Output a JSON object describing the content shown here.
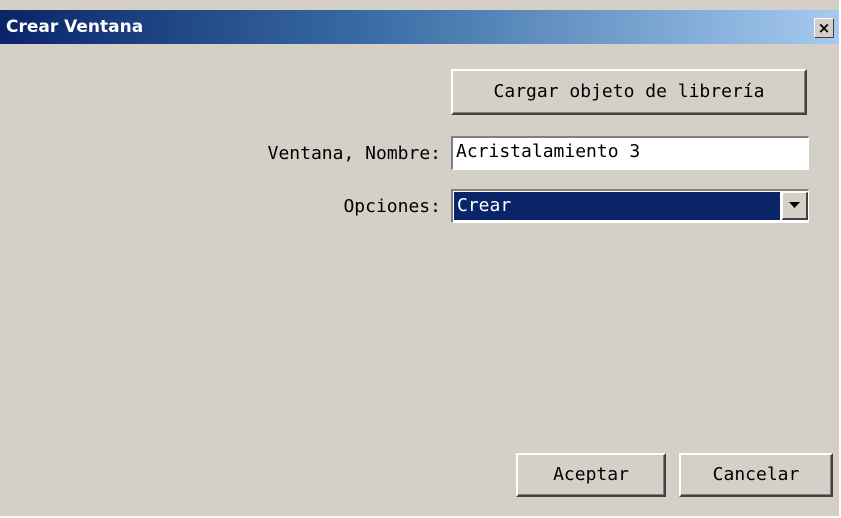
{
  "window": {
    "title": "Crear Ventana",
    "close_label": "×"
  },
  "form": {
    "load_library_label": "Cargar objeto de librería",
    "name_label": "Ventana, Nombre:",
    "name_value": "Acristalamiento 3",
    "options_label": "Opciones:",
    "options_selected": "Crear"
  },
  "footer": {
    "accept_label": "Aceptar",
    "cancel_label": "Cancelar"
  },
  "colors": {
    "dialog_face": "#d4d0c8",
    "titlebar_start": "#0a246a",
    "titlebar_end": "#a6caf0",
    "selection": "#0a246a"
  },
  "icons": {
    "close": "close-icon",
    "dropdown": "chevron-down-icon"
  }
}
